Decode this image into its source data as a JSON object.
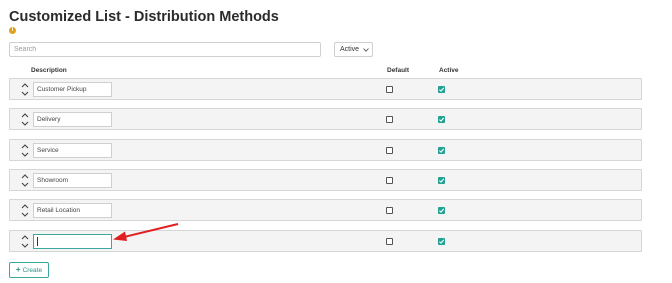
{
  "page": {
    "title": "Customized List - Distribution Methods"
  },
  "toolbar": {
    "search_placeholder": "Search",
    "search_value": "",
    "status_filter": "Active",
    "info_icon": "info-icon",
    "filter_icon": "chevron-down-icon"
  },
  "columns": {
    "description": "Description",
    "default": "Default",
    "active": "Active"
  },
  "rows": [
    {
      "description": "Customer Pickup",
      "default": false,
      "active": true
    },
    {
      "description": "Delivery",
      "default": false,
      "active": true
    },
    {
      "description": "Service",
      "default": false,
      "active": true
    },
    {
      "description": "Showroom",
      "default": false,
      "active": true
    },
    {
      "description": "Retail Location",
      "default": false,
      "active": true
    },
    {
      "description": "",
      "default": false,
      "active": true
    }
  ],
  "actions": {
    "create_label": "Create",
    "create_icon": "plus-icon"
  },
  "colors": {
    "accent": "#23a193",
    "title_text": "#2b2b2b",
    "row_background": "#f4f4f4",
    "warning_icon": "#e0a017",
    "annotation_arrow": "#e02020"
  }
}
